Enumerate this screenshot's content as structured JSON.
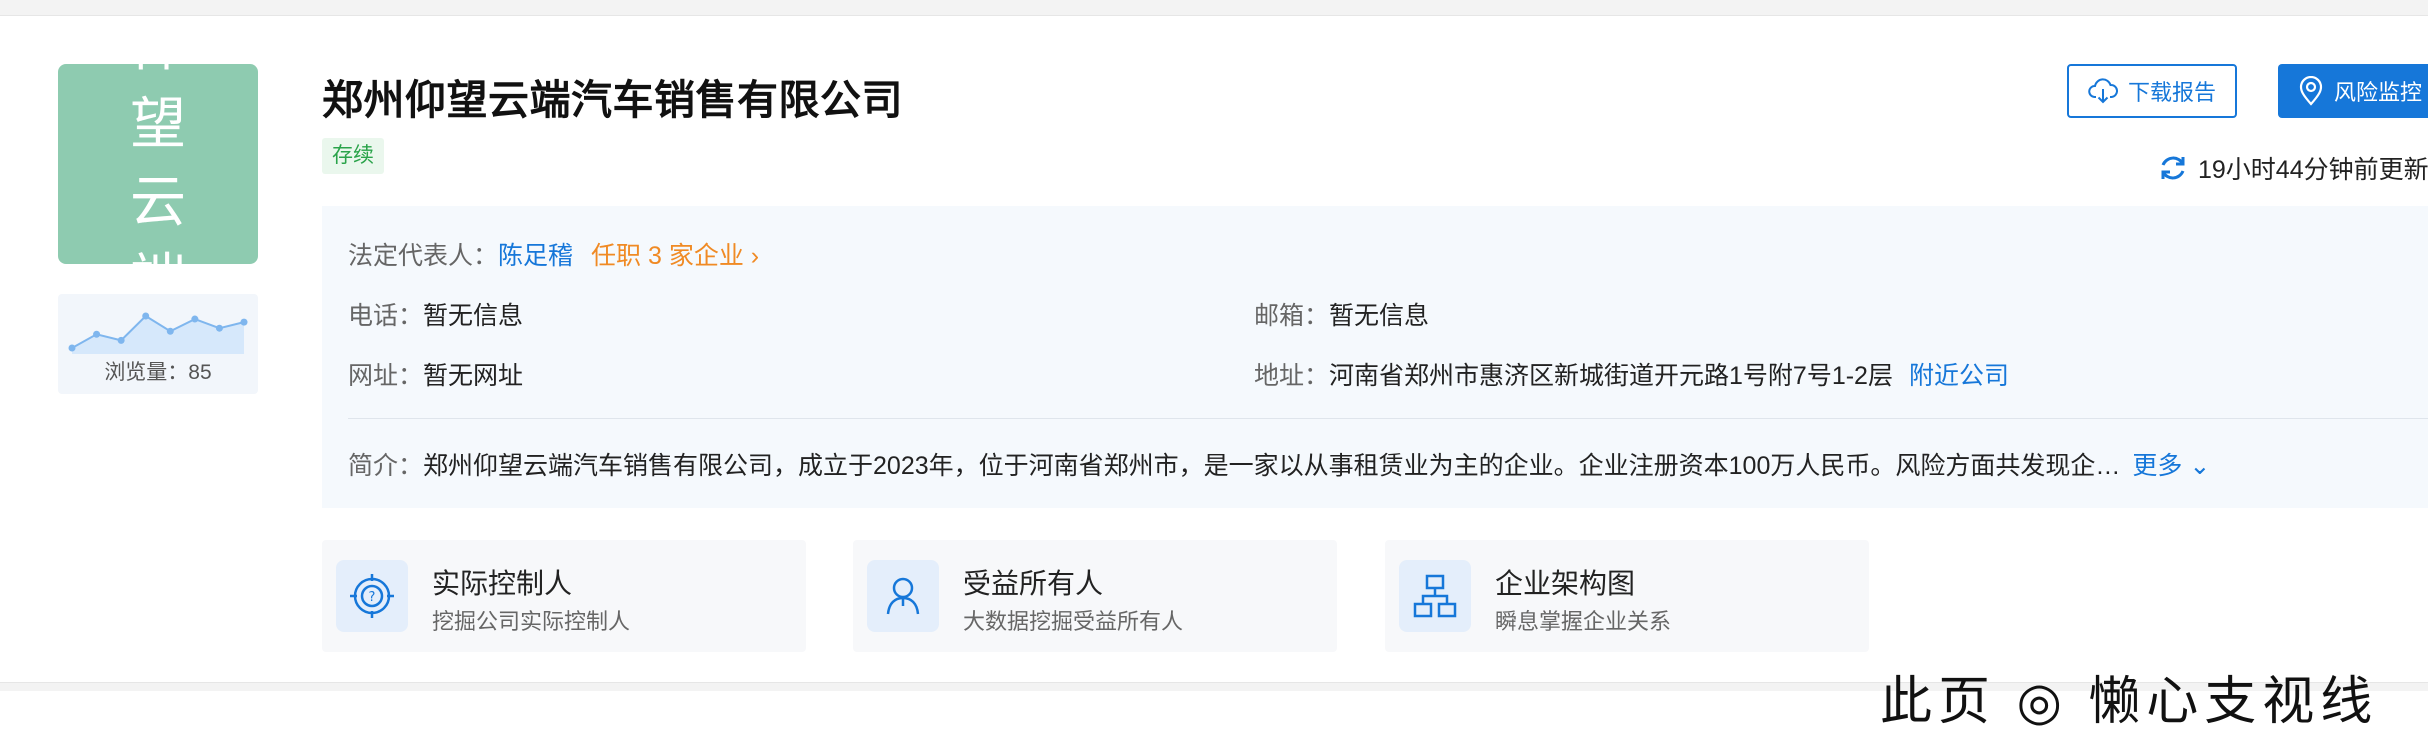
{
  "company": {
    "name": "郑州仰望云端汽车销售有限公司",
    "logo_text": "仰望云端",
    "status": "存续",
    "views_label": "浏览量：85",
    "views_trend": [
      3,
      12,
      8,
      24,
      14,
      22,
      16,
      20
    ]
  },
  "actions": {
    "download_label": "下载报告",
    "risk_label": "风险监控",
    "update_text": "19小时44分钟前更新"
  },
  "info": {
    "legal_rep_key": "法定代表人：",
    "legal_rep_value": "陈足稽",
    "legal_rep_jobs": "任职 3 家企业",
    "phone_key": "电话：",
    "phone_value": "暂无信息",
    "email_key": "邮箱：",
    "email_value": "暂无信息",
    "website_key": "网址：",
    "website_value": "暂无网址",
    "address_key": "地址：",
    "address_value": "河南省郑州市惠济区新城街道开元路1号附7号1-2层",
    "nearby_label": "附近公司",
    "intro_key": "简介：",
    "intro_value": "郑州仰望云端汽车销售有限公司，成立于2023年，位于河南省郑州市，是一家以从事租赁业为主的企业。企业注册资本100万人民币。风险方面共发现企…",
    "more_label": "更多"
  },
  "cards": [
    {
      "title": "实际控制人",
      "sub": "挖掘公司实际控制人",
      "icon": "target-question-icon"
    },
    {
      "title": "受益所有人",
      "sub": "大数据挖掘受益所有人",
      "icon": "person-icon"
    },
    {
      "title": "企业架构图",
      "sub": "瞬息掌握企业关系",
      "icon": "org-chart-icon"
    }
  ],
  "footer_partial": "此页 ◎ 懒心支视线",
  "colors": {
    "accent": "#1677d9",
    "logo_bg": "#8ecbb0",
    "status_green": "#2aa34a",
    "orange_link": "#f08a24"
  }
}
